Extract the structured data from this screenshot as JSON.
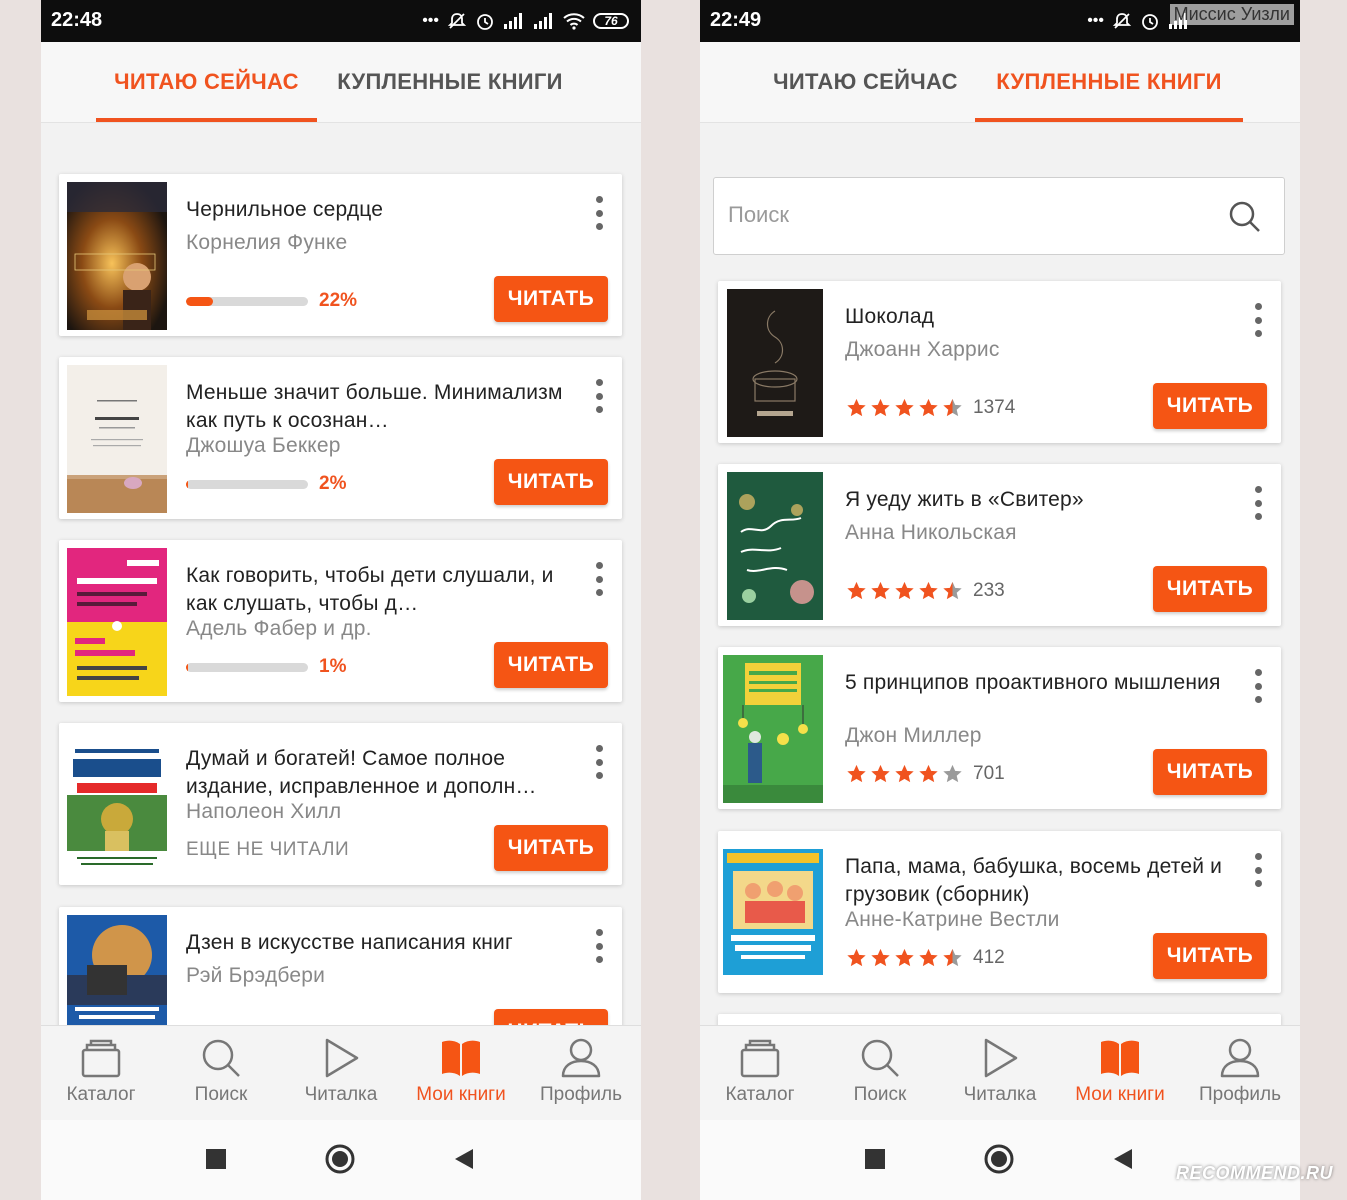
{
  "left": {
    "status": {
      "time": "22:48",
      "battery": "76"
    },
    "tabs": {
      "reading": "ЧИТАЮ СЕЙЧАС",
      "purchased": "КУПЛЕННЫЕ КНИГИ"
    },
    "books": [
      {
        "title": "Чернильное сердце",
        "author": "Корнелия Функе",
        "progress_label": "22%",
        "progress": 0.22,
        "button": "ЧИТАТЬ"
      },
      {
        "title": "Меньше значит больше. Минимализм как путь к осознан…",
        "author": "Джошуа Беккер",
        "progress_label": "2%",
        "progress": 0.02,
        "button": "ЧИТАТЬ"
      },
      {
        "title": "Как говорить, чтобы дети слушали, и как слушать, чтобы д…",
        "author": "Адель Фабер и др.",
        "progress_label": "1%",
        "progress": 0.01,
        "button": "ЧИТАТЬ"
      },
      {
        "title": "Думай и богатей! Самое полное издание, исправленное и дополн…",
        "author": "Наполеон Хилл",
        "status": "ЕЩЕ НЕ ЧИТАЛИ",
        "button": "ЧИТАТЬ"
      },
      {
        "title": "Дзен в искусстве написания книг",
        "author": "Рэй Брэдбери",
        "button": "ЧИТАТЬ"
      }
    ]
  },
  "right": {
    "status": {
      "time": "22:49"
    },
    "tabs": {
      "reading": "ЧИТАЮ СЕЙЧАС",
      "purchased": "КУПЛЕННЫЕ КНИГИ"
    },
    "search": {
      "placeholder": "Поиск"
    },
    "books": [
      {
        "title": "Шоколад",
        "author": "Джоанн Харрис",
        "rating": 4.5,
        "count": "1374",
        "button": "ЧИТАТЬ"
      },
      {
        "title": "Я уеду жить в «Свитер»",
        "author": "Анна Никольская",
        "rating": 4.5,
        "count": "233",
        "button": "ЧИТАТЬ"
      },
      {
        "title": "5 принципов проактивного мышления",
        "author": "Джон Миллер",
        "rating": 4,
        "count": "701",
        "button": "ЧИТАТЬ"
      },
      {
        "title": "Папа, мама, бабушка, восемь детей и грузовик (сборник)",
        "author": "Анне-Катрине Вестли",
        "rating": 4.5,
        "count": "412",
        "button": "ЧИТАТЬ"
      }
    ]
  },
  "nav": {
    "catalog": "Каталог",
    "search": "Поиск",
    "reader": "Читалка",
    "mybooks": "Мои книги",
    "profile": "Профиль"
  },
  "watermark": "Миссис Уизли",
  "site_badge": "RECOMMEND.RU",
  "colors": {
    "accent": "#f55514",
    "star": "#f0531f"
  },
  "icons": [
    "signal-icon",
    "wifi-icon",
    "alarm-icon",
    "mute-icon",
    "kebab-menu-icon",
    "search-icon",
    "catalog-icon",
    "reader-play-icon",
    "book-icon",
    "profile-icon",
    "stop-icon",
    "home-icon",
    "back-icon"
  ]
}
